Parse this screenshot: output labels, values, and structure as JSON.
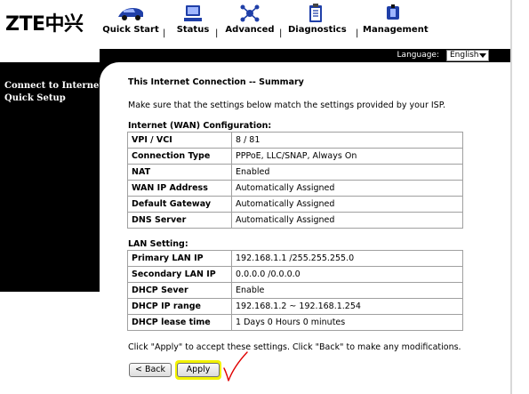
{
  "brand": {
    "logo_text": "ZTE中兴"
  },
  "nav": {
    "items": [
      {
        "label": "Quick Start",
        "icon": "car-icon"
      },
      {
        "label": "Status",
        "icon": "monitor-icon"
      },
      {
        "label": "Advanced",
        "icon": "network-icon"
      },
      {
        "label": "Diagnostics",
        "icon": "clipboard-icon"
      },
      {
        "label": "Management",
        "icon": "tools-icon"
      }
    ],
    "separator": "|"
  },
  "language": {
    "label": "Language:",
    "value": "English"
  },
  "sidebar": {
    "items": [
      {
        "label": "Connect to Internet"
      },
      {
        "label": "Quick Setup"
      }
    ]
  },
  "content": {
    "title": "This Internet Connection -- Summary",
    "intro": "Make sure that the settings below match the settings provided by your ISP.",
    "wan": {
      "heading": "Internet (WAN) Configuration:",
      "rows": [
        {
          "key": "VPI / VCI",
          "value": "8 / 81"
        },
        {
          "key": "Connection Type",
          "value": "PPPoE, LLC/SNAP, Always On"
        },
        {
          "key": "NAT",
          "value": "Enabled"
        },
        {
          "key": "WAN IP Address",
          "value": "Automatically Assigned"
        },
        {
          "key": "Default Gateway",
          "value": "Automatically Assigned"
        },
        {
          "key": "DNS Server",
          "value": "Automatically Assigned"
        }
      ]
    },
    "lan": {
      "heading": "LAN Setting:",
      "rows": [
        {
          "key": "Primary LAN IP",
          "value": "192.168.1.1 /255.255.255.0"
        },
        {
          "key": "Secondary LAN IP",
          "value": "0.0.0.0 /0.0.0.0"
        },
        {
          "key": "DHCP Sever",
          "value": "Enable"
        },
        {
          "key": "DHCP IP range",
          "value": "192.168.1.2 ~ 192.168.1.254"
        },
        {
          "key": "DHCP lease time",
          "value": "1 Days 0 Hours 0 minutes"
        }
      ]
    },
    "footer_note": "Click \"Apply\" to accept these settings. Click \"Back\" to make any modifications."
  },
  "buttons": {
    "back": "< Back",
    "apply": "Apply"
  },
  "colors": {
    "sidebar_bg": "#000000",
    "apply_highlight": "#f2f200",
    "checkmark": "#e00000",
    "nav_icon": "#1f3fa8"
  }
}
